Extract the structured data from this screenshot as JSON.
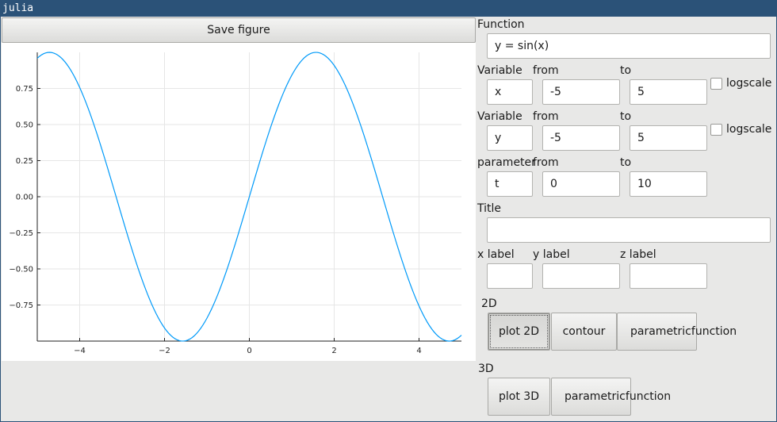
{
  "window": {
    "title": "julia"
  },
  "toolbar": {
    "save_label": "Save figure"
  },
  "function": {
    "label": "Function",
    "value": "y = sin(x)"
  },
  "var1": {
    "label": "Variable",
    "from_label": "from",
    "to_label": "to",
    "name": "x",
    "from": "-5",
    "to": "5",
    "logscale_label": "logscale",
    "logscale": false
  },
  "var2": {
    "label": "Variable",
    "from_label": "from",
    "to_label": "to",
    "name": "y",
    "from": "-5",
    "to": "5",
    "logscale_label": "logscale",
    "logscale": false
  },
  "param": {
    "label": "parameter",
    "from_label": "from",
    "to_label": "to",
    "name": "t",
    "from": "0",
    "to": "10"
  },
  "title_field": {
    "label": "Title",
    "value": ""
  },
  "axis_labels": {
    "x_label": "x label",
    "y_label": "y label",
    "z_label": "z label",
    "x_value": "",
    "y_value": "",
    "z_value": ""
  },
  "section_2d": {
    "label": "2D",
    "plot": "plot 2D",
    "contour": "contour",
    "param_line1": "parametric",
    "param_line2": "function"
  },
  "section_3d": {
    "label": "3D",
    "plot": "plot 3D",
    "param_line1": "parametric",
    "param_line2": "function"
  },
  "chart_data": {
    "type": "line",
    "function": "sin(x)",
    "title": "",
    "xlabel": "",
    "ylabel": "",
    "xlim": [
      -5,
      5
    ],
    "ylim": [
      -1,
      1
    ],
    "xticks": [
      -4,
      -2,
      0,
      2,
      4
    ],
    "xtick_labels": [
      "−4",
      "−2",
      "0",
      "2",
      "4"
    ],
    "yticks": [
      0.75,
      0.5,
      0.25,
      0,
      -0.25,
      -0.5,
      -0.75
    ],
    "ytick_labels": [
      "0.75",
      "0.50",
      "0.25",
      "0.00",
      "−0.25",
      "−0.50",
      "−0.75"
    ],
    "grid": true,
    "series": [
      {
        "color": "#009af9",
        "samples": 200
      }
    ]
  }
}
